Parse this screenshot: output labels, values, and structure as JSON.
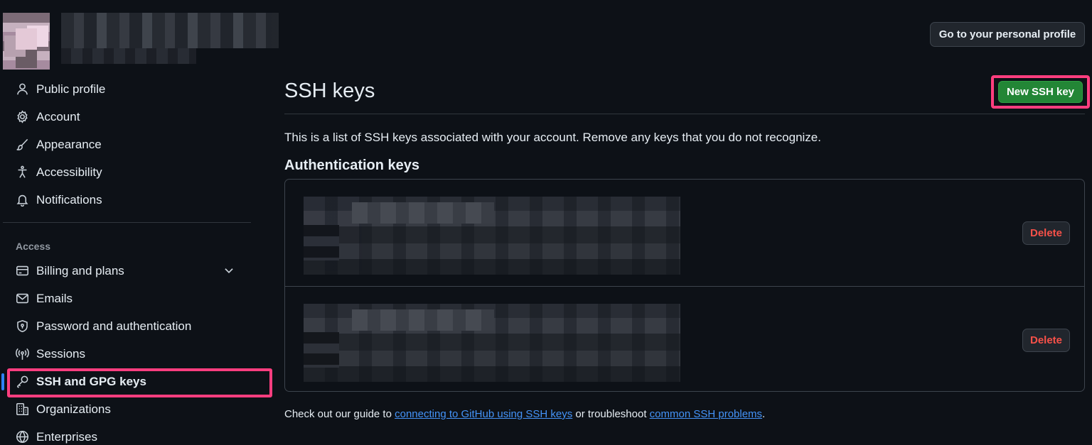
{
  "colors": {
    "background": "#0d1117",
    "accent_pink": "#ff3e7f",
    "primary_green": "#238636",
    "danger_red": "#f85149",
    "link_blue": "#4493f8",
    "active_blue": "#2f81f7"
  },
  "sidebar": {
    "items_top": [
      {
        "label": "Public profile",
        "icon": "person-icon"
      },
      {
        "label": "Account",
        "icon": "gear-icon"
      },
      {
        "label": "Appearance",
        "icon": "paintbrush-icon"
      },
      {
        "label": "Accessibility",
        "icon": "accessibility-icon"
      },
      {
        "label": "Notifications",
        "icon": "bell-icon"
      }
    ],
    "section_label": "Access",
    "items_access": [
      {
        "label": "Billing and plans",
        "icon": "credit-card-icon"
      },
      {
        "label": "Emails",
        "icon": "mail-icon"
      },
      {
        "label": "Password and authentication",
        "icon": "shield-lock-icon"
      },
      {
        "label": "Sessions",
        "icon": "broadcast-icon"
      },
      {
        "label": "SSH and GPG keys",
        "icon": "key-icon"
      },
      {
        "label": "Organizations",
        "icon": "organization-icon"
      },
      {
        "label": "Enterprises",
        "icon": "globe-icon"
      }
    ]
  },
  "header": {
    "profile_button": "Go to your personal profile"
  },
  "main": {
    "title": "SSH keys",
    "new_key_button": "New SSH key",
    "description": "This is a list of SSH keys associated with your account. Remove any keys that you do not recognize.",
    "section_heading": "Authentication keys",
    "keys": [
      {
        "delete_label": "Delete"
      },
      {
        "delete_label": "Delete"
      }
    ],
    "footer": {
      "prefix": "Check out our guide to ",
      "link1": "connecting to GitHub using SSH keys",
      "middle": " or troubleshoot ",
      "link2": "common SSH problems",
      "suffix": "."
    }
  }
}
